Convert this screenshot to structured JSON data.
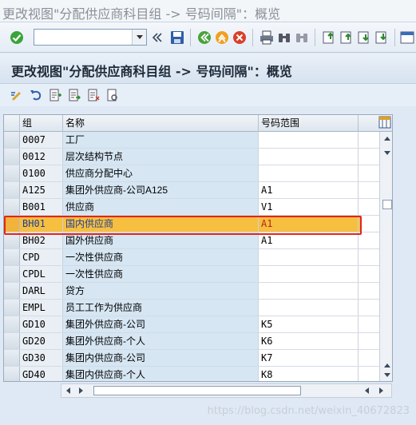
{
  "window": {
    "title": "更改视图\"分配供应商科目组 -> 号码间隔\"：概览"
  },
  "toolbar": {
    "command_field_value": "",
    "icons": [
      "enter-check-icon",
      "save-icon",
      "back-icon",
      "exit-icon",
      "cancel-icon",
      "print-icon",
      "find-icon",
      "find-next-icon",
      "first-page-icon",
      "previous-page-icon",
      "next-page-icon",
      "last-page-icon"
    ]
  },
  "screen": {
    "heading": "更改视图\"分配供应商科目组 -> 号码间隔\"：概览"
  },
  "app_toolbar": {
    "icons": [
      "display-change-icon",
      "undo-icon",
      "new-entries-icon",
      "copy-as-icon",
      "delete-icon",
      "select-all-icon"
    ]
  },
  "table": {
    "columns": [
      "组",
      "名称",
      "号码范围"
    ],
    "rows": [
      {
        "group": "0007",
        "name": "工厂",
        "range": ""
      },
      {
        "group": "0012",
        "name": "层次结构节点",
        "range": ""
      },
      {
        "group": "0100",
        "name": "供应商分配中心",
        "range": ""
      },
      {
        "group": "A125",
        "name": "集团外供应商-公司A125",
        "range": "A1"
      },
      {
        "group": "B001",
        "name": "供应商",
        "range": "V1"
      },
      {
        "group": "BH01",
        "name": "国内供应商",
        "range": "A1",
        "highlighted": true
      },
      {
        "group": "BH02",
        "name": "国外供应商",
        "range": "A1"
      },
      {
        "group": "CPD",
        "name": "一次性供应商",
        "range": ""
      },
      {
        "group": "CPDL",
        "name": "一次性供应商",
        "range": ""
      },
      {
        "group": "DARL",
        "name": "贷方",
        "range": ""
      },
      {
        "group": "EMPL",
        "name": "员工工作为供应商",
        "range": ""
      },
      {
        "group": "GD10",
        "name": "集团外供应商-公司",
        "range": "K5"
      },
      {
        "group": "GD20",
        "name": "集团外供应商-个人",
        "range": "K6"
      },
      {
        "group": "GD30",
        "name": "集团内供应商-公司",
        "range": "K7"
      },
      {
        "group": "GD40",
        "name": "集团内供应商-个人",
        "range": "K8"
      }
    ]
  },
  "colors": {
    "highlight_row": "#f6bf3f",
    "annotation_box": "#e3241b",
    "name_column": "#d6e6f3"
  },
  "watermark": "https://blog.csdn.net/weixin_40672823"
}
